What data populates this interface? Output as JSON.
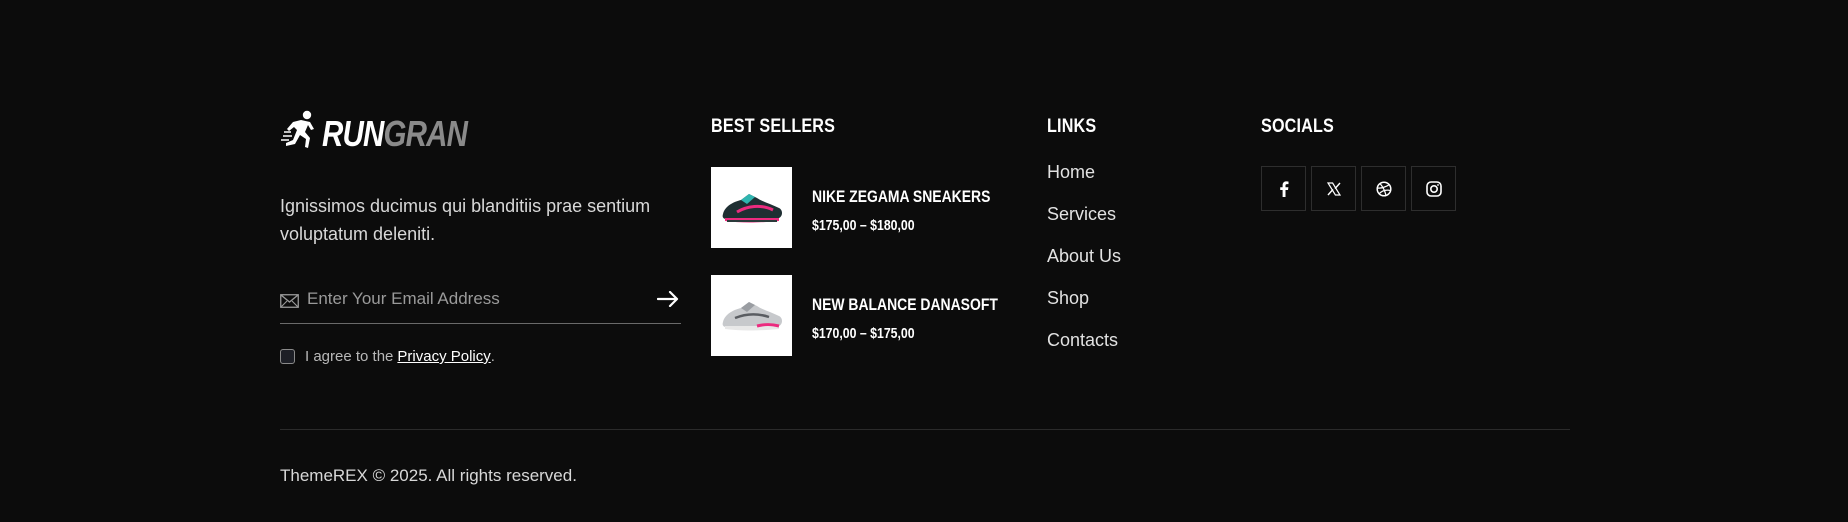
{
  "brand": {
    "word_part1": "RUN",
    "word_part2": "GRAN"
  },
  "about": {
    "description": "Ignissimos ducimus qui blanditiis prae sentium voluptatum deleniti."
  },
  "subscribe": {
    "placeholder": "Enter Your Email Address",
    "agree_prefix": "I agree to the",
    "privacy_link": "Privacy Policy",
    "agree_suffix": "."
  },
  "best_sellers": {
    "heading": "BEST SELLERS",
    "products": [
      {
        "name": "NIKE ZEGAMA SNEAKERS",
        "price": "$175,00 – $180,00"
      },
      {
        "name": "NEW BALANCE DANASOFT",
        "price": "$170,00 – $175,00"
      }
    ]
  },
  "links": {
    "heading": "LINKS",
    "items": [
      "Home",
      "Services",
      "About Us",
      "Shop",
      "Contacts"
    ]
  },
  "socials": {
    "heading": "SOCIALS",
    "icons": [
      "facebook-icon",
      "x-twitter-icon",
      "dribbble-icon",
      "instagram-icon"
    ]
  },
  "copyright": "ThemeREX © 2025. All rights reserved.",
  "colors": {
    "background": "#0c0c0c",
    "text": "#e8e8e8",
    "muted": "#8a8a8a",
    "shoe1_accent": "#e8207a",
    "shoe2_accent": "#e8207a"
  }
}
